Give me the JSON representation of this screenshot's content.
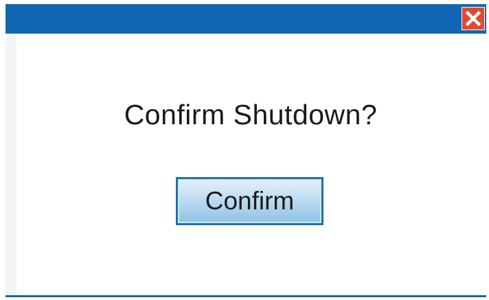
{
  "dialog": {
    "message": "Confirm Shutdown?",
    "confirm_label": "Confirm",
    "close_icon": "close-icon"
  },
  "colors": {
    "title_bar": "#1166b4",
    "close_button": "#e04a2e",
    "button_border": "#1a6fb8",
    "button_fill_top": "#e4f1fb",
    "button_fill_bottom": "#8fc2e6"
  }
}
